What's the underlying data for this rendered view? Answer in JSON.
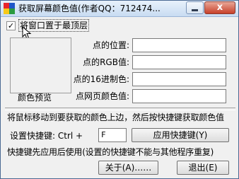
{
  "window": {
    "title": "获取屏幕颜色值(作者QQ：712474...",
    "close_glyph": "x"
  },
  "options": {
    "always_on_top_label": "将窗口置于最顶层",
    "always_on_top_checked": true
  },
  "preview": {
    "label": "颜色预览"
  },
  "fields": {
    "position_label": "点的位置:",
    "position_value": "",
    "rgb_label": "点的RGB值:",
    "rgb_value": "",
    "hex_label": "点的16进制色:",
    "hex_value": "",
    "web_label": "点网页颜色值:",
    "web_value": ""
  },
  "instruction": "将鼠标移动到要获取的颜色上边，然后按快捷键获取颜色值",
  "hotkey": {
    "label": "设置快捷键: Ctrl  +",
    "value": "F",
    "apply_label": "应用快捷键(Y)"
  },
  "note": "快捷键先应用后使用(设置的快捷键不能与其他程序重复)",
  "buttons": {
    "about_label": "关于(A)……",
    "exit_label": "退出(E)"
  },
  "colors": {
    "icon_red": "#e8262b",
    "icon_blue": "#1f56c9",
    "icon_yellow": "#f7c918",
    "icon_green": "#2b9b3e"
  },
  "icons": [
    "app-icon",
    "minimize-icon",
    "close-icon",
    "check-icon",
    "mouse-cursor-icon"
  ]
}
